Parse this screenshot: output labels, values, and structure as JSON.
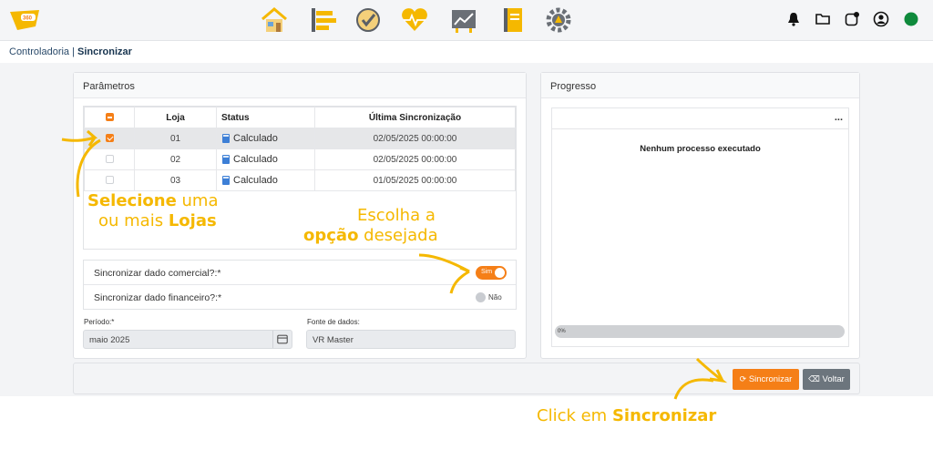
{
  "breadcrumb": {
    "parent": "Controladoria",
    "separator": " | ",
    "current": "Sincronizar"
  },
  "nav_icons": [
    "home-icon",
    "tasks-icon",
    "check-icon",
    "health-icon",
    "chart-icon",
    "notebook-icon",
    "settings-icon"
  ],
  "top_right_icons": [
    "bell-icon",
    "folder-icon",
    "notification-icon",
    "user-icon",
    "status-dot-icon"
  ],
  "params": {
    "title": "Parâmetros",
    "table": {
      "headers": [
        "Loja",
        "Status",
        "Última Sincronização"
      ],
      "rows": [
        {
          "loja": "01",
          "status": "Calculado",
          "data": "02/05/2025 00:00:00",
          "checked": true
        },
        {
          "loja": "02",
          "status": "Calculado",
          "data": "02/05/2025 00:00:00",
          "checked": false
        },
        {
          "loja": "03",
          "status": "Calculado",
          "data": "01/05/2025 00:00:00",
          "checked": false
        }
      ]
    },
    "opt_comercial": {
      "label": "Sincronizar dado comercial?:*",
      "toggle": "Sim"
    },
    "opt_financeiro": {
      "label": "Sincronizar dado financeiro?:*",
      "toggle": "Não"
    },
    "periodo": {
      "label": "Período:*",
      "value": "maio 2025"
    },
    "fonte": {
      "label": "Fonte de dados:",
      "value": "VR Master"
    }
  },
  "progress": {
    "title": "Progresso",
    "menu": "...",
    "empty_msg": "Nenhum processo executado",
    "bar_text": "0%",
    "value": 0
  },
  "buttons": {
    "sync": "Sincronizar",
    "back": "Voltar"
  },
  "annotations": {
    "a1_bold": "Selecione",
    "a1_rest": " uma",
    "a1_line2_pre": "ou mais ",
    "a1_line2_bold": "Lojas",
    "a2_line1": "Escolha a",
    "a2_bold": "opção",
    "a2_rest": " desejada",
    "a3_pre": "Click em ",
    "a3_bold": "Sincronizar"
  },
  "colors": {
    "accent": "#f57f17",
    "annotation": "#f5b800",
    "back_button": "#6c757d"
  }
}
